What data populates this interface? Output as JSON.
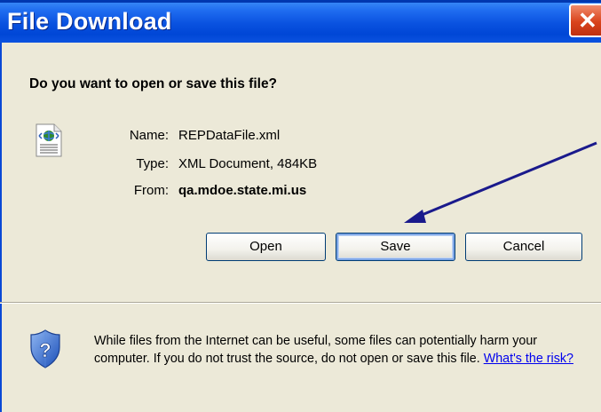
{
  "window": {
    "title": "File Download",
    "close_glyph": "✕"
  },
  "dialog": {
    "question": "Do you want to open or save this file?",
    "file_icon": "xml-document-icon",
    "fields": {
      "name_label": "Name:",
      "name_value": "REPDataFile.xml",
      "type_label": "Type:",
      "type_value": "XML Document, 484KB",
      "from_label": "From:",
      "from_value": "qa.mdoe.state.mi.us"
    },
    "buttons": {
      "open": "Open",
      "save": "Save",
      "cancel": "Cancel"
    },
    "warning": {
      "icon": "shield-question-icon",
      "text": "While files from the Internet can be useful, some files can potentially harm your computer. If you do not trust the source, do not open or save this file.",
      "link": "What's the risk?"
    }
  },
  "annotation": {
    "arrow_color": "#1a1a8c",
    "points_to": "save-button"
  },
  "colors": {
    "titlebar": "#0a52e0",
    "dialog_bg": "#ece9d8",
    "close_button": "#d9431c",
    "link": "#0000ee"
  }
}
